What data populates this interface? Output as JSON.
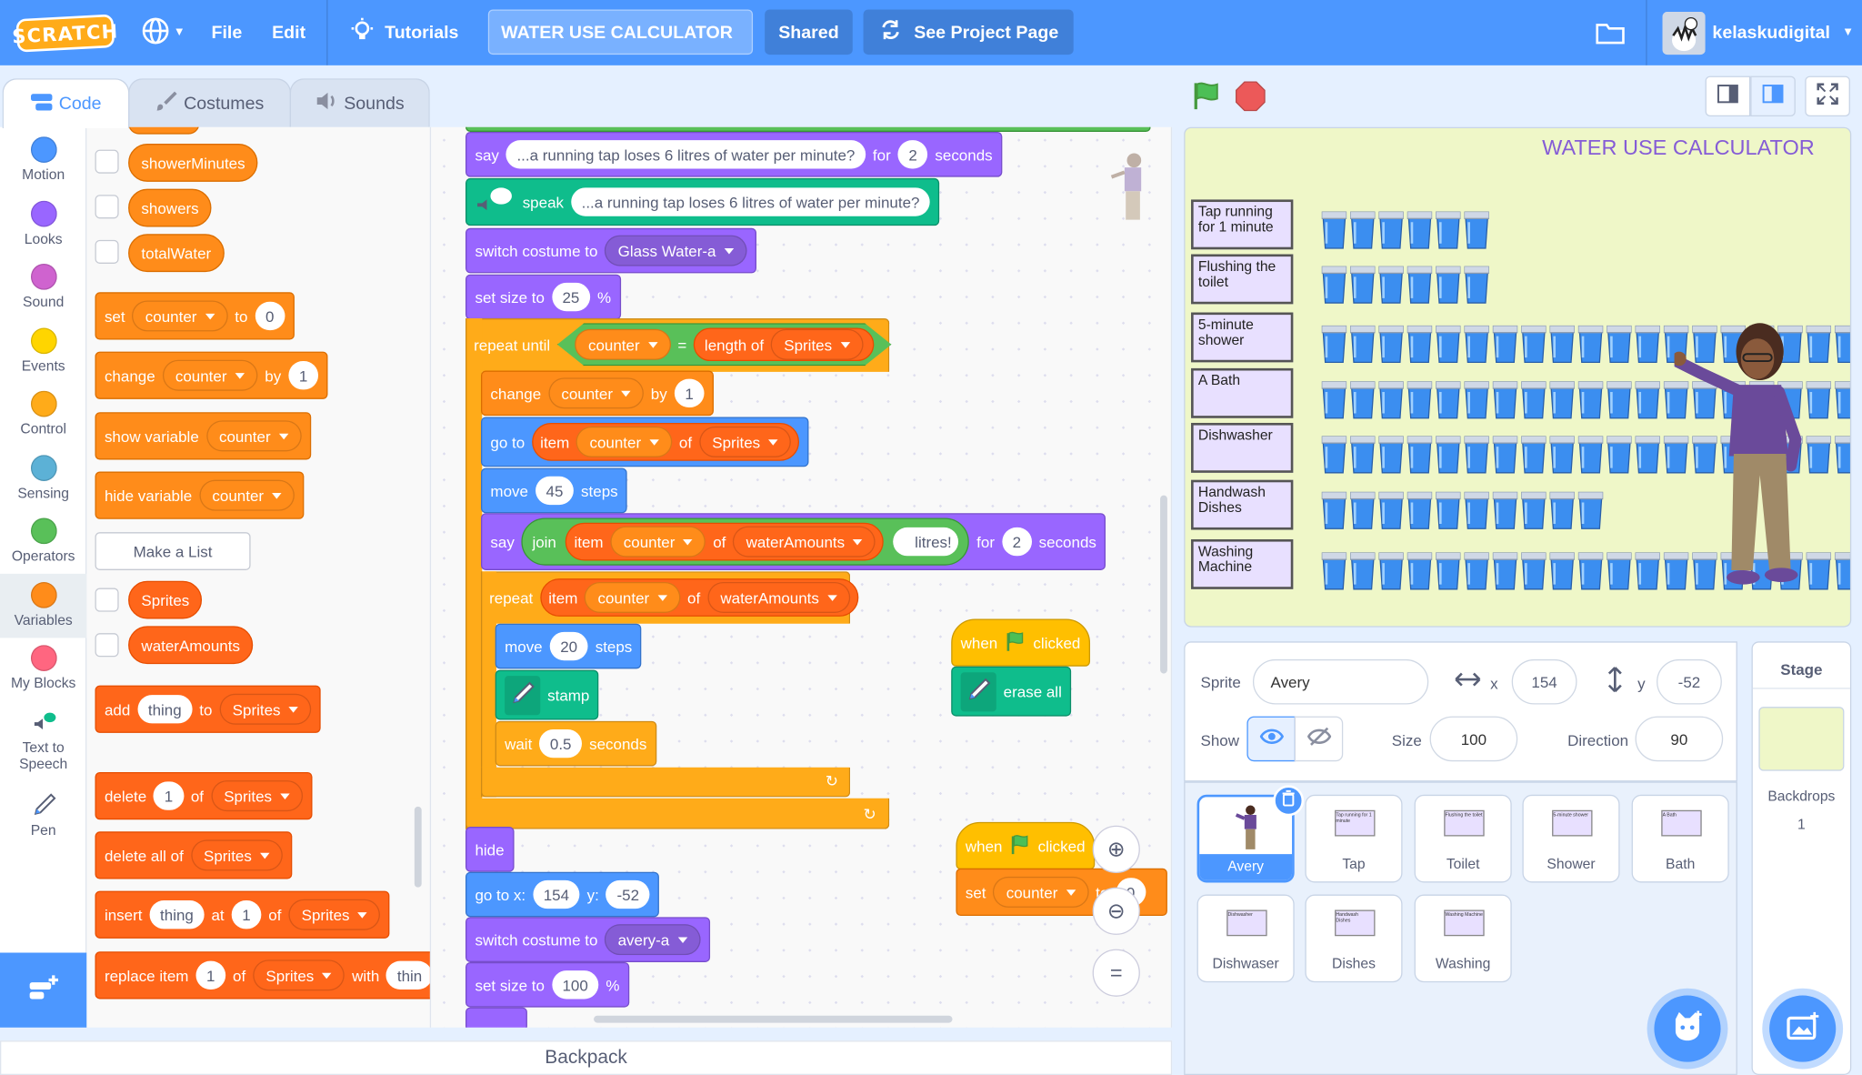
{
  "menubar": {
    "logo": "SCRATCH",
    "file": "File",
    "edit": "Edit",
    "tutorials": "Tutorials",
    "project_title": "WATER USE CALCULATOR",
    "shared": "Shared",
    "see_project": "See Project Page",
    "username": "kelaskudigital"
  },
  "tabs": {
    "code": "Code",
    "costumes": "Costumes",
    "sounds": "Sounds"
  },
  "categories": [
    "Motion",
    "Looks",
    "Sound",
    "Events",
    "Control",
    "Sensing",
    "Operators",
    "Variables",
    "My Blocks",
    "Text to Speech",
    "Pen"
  ],
  "category_colors": [
    "#4c97ff",
    "#9966ff",
    "#cf63cf",
    "#ffd500",
    "#ffab19",
    "#5cb1d6",
    "#59c059",
    "#ff8c1a",
    "#ff6680"
  ],
  "flyout": {
    "vars": [
      "showerMinutes",
      "showers",
      "totalWater"
    ],
    "set": "set",
    "to": "to",
    "counter": "counter",
    "zero": "0",
    "change": "change",
    "by": "by",
    "one": "1",
    "show_variable": "show variable",
    "hide_variable": "hide variable",
    "make_list": "Make a List",
    "lists": [
      "Sprites",
      "waterAmounts"
    ],
    "add": "add",
    "thing": "thing",
    "sprites": "Sprites",
    "delete": "delete",
    "of": "of",
    "delete_all": "delete all of",
    "insert": "insert",
    "at": "at",
    "replace": "replace item",
    "with": "with",
    "thin": "thin"
  },
  "script": {
    "say": "say",
    "tap_msg": "...a running tap loses 6 litres of water per minute?",
    "for": "for",
    "two": "2",
    "seconds": "seconds",
    "speak": "speak",
    "switch_costume": "switch costume to",
    "glass": "Glass Water-a",
    "set_size": "set size to",
    "size25": "25",
    "pct": "%",
    "repeat_until": "repeat until",
    "counter": "counter",
    "eq": "=",
    "length_of": "length of",
    "sprites": "Sprites",
    "change": "change",
    "by": "by",
    "one": "1",
    "go_to": "go to",
    "item": "item",
    "of": "of",
    "move": "move",
    "steps": "steps",
    "m45": "45",
    "join": "join",
    "waterAmounts": "waterAmounts",
    "litres": "litres!",
    "repeat": "repeat",
    "m20": "20",
    "stamp": "stamp",
    "wait": "wait",
    "w05": "0.5",
    "hide": "hide",
    "go_to_xy": "go to x:",
    "x154": "154",
    "y": "y:",
    "ym52": "-52",
    "avery_a": "avery-a",
    "size100": "100",
    "when": "when",
    "clicked": "clicked",
    "erase_all": "erase all",
    "set": "set",
    "to": "to",
    "zero": "0"
  },
  "backpack": "Backpack",
  "stage": {
    "title": "WATER USE CALCULATOR",
    "labels": [
      "Tap running for 1 minute",
      "Flushing the toilet",
      "5-minute shower",
      "A Bath",
      "Dishwasher",
      "Handwash Dishes",
      "Washing Machine"
    ],
    "glass_counts": [
      6,
      6,
      19,
      19,
      19,
      10,
      19
    ]
  },
  "sprite_info": {
    "sprite_label": "Sprite",
    "sprite_name": "Avery",
    "x_label": "x",
    "x": "154",
    "y_label": "y",
    "y": "-52",
    "show_label": "Show",
    "size_label": "Size",
    "size": "100",
    "direction_label": "Direction",
    "direction": "90"
  },
  "sprites": [
    "Avery",
    "Tap",
    "Toilet",
    "Shower",
    "Bath",
    "Dishwaser",
    "Dishes",
    "Washing"
  ],
  "sprite_thumb_text": [
    "",
    "Tap running for 1 minute",
    "Flushing the toilet",
    "5-minute shower",
    "A Bath",
    "Dishwasher",
    "Handwash Dishes",
    "Washing Machine"
  ],
  "stage_panel": {
    "title": "Stage",
    "backdrops": "Backdrops",
    "count": "1"
  }
}
